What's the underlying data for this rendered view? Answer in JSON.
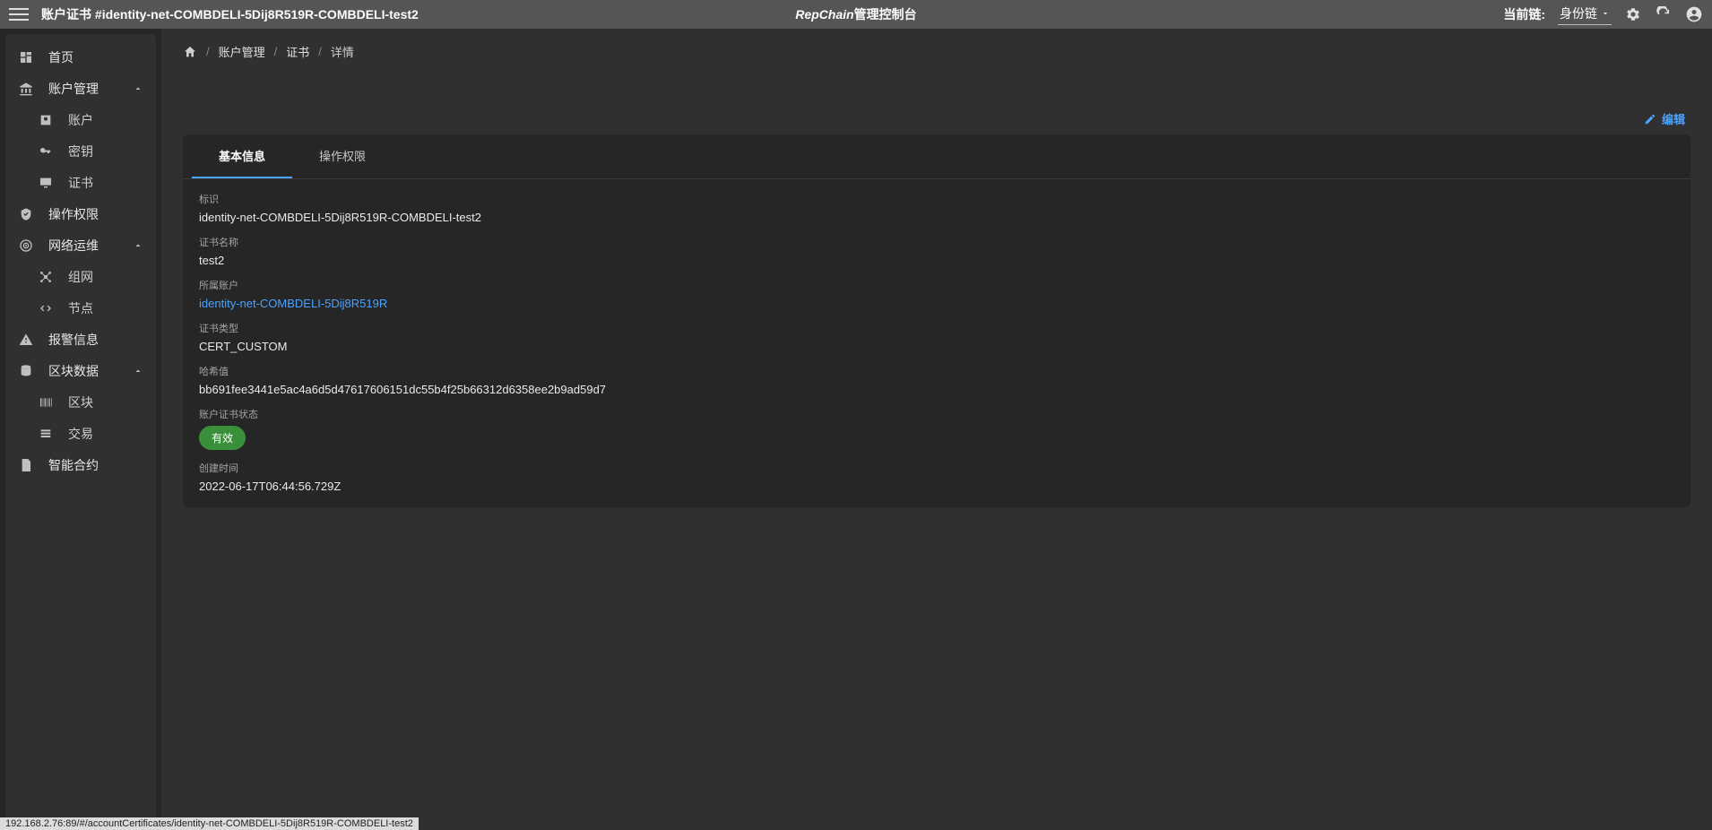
{
  "topbar": {
    "page_title_prefix": "账户证书 #",
    "page_title_id": "identity-net-COMBDELI-5Dij8R519R-COMBDELI-test2",
    "app_title_italic": "RepChain",
    "app_title_rest": "管理控制台",
    "chain_label": "当前链:",
    "chain_selected": "身份链"
  },
  "sidebar": {
    "home": "首页",
    "account_mgmt": "账户管理",
    "account": "账户",
    "key": "密钥",
    "cert": "证书",
    "op_perm": "操作权限",
    "net_ops": "网络运维",
    "network": "组网",
    "node": "节点",
    "alert": "报警信息",
    "block_data": "区块数据",
    "block": "区块",
    "tx": "交易",
    "contract": "智能合约"
  },
  "crumbs": {
    "c1": "账户管理",
    "c2": "证书",
    "c3": "详情"
  },
  "edit_btn": "编辑",
  "tabs": {
    "basic": "基本信息",
    "perm": "操作权限"
  },
  "fields": {
    "id_label": "标识",
    "id_value": "identity-net-COMBDELI-5Dij8R519R-COMBDELI-test2",
    "name_label": "证书名称",
    "name_value": "test2",
    "owner_label": "所属账户",
    "owner_value": "identity-net-COMBDELI-5Dij8R519R",
    "type_label": "证书类型",
    "type_value": "CERT_CUSTOM",
    "hash_label": "哈希值",
    "hash_value": "bb691fee3441e5ac4a6d5d47617606151dc55b4f25b66312d6358ee2b9ad59d7",
    "status_label": "账户证书状态",
    "status_value": "有效",
    "created_label": "创建时间",
    "created_value": "2022-06-17T06:44:56.729Z"
  },
  "status_url": "192.168.2.76:89/#/accountCertificates/identity-net-COMBDELI-5Dij8R519R-COMBDELI-test2"
}
